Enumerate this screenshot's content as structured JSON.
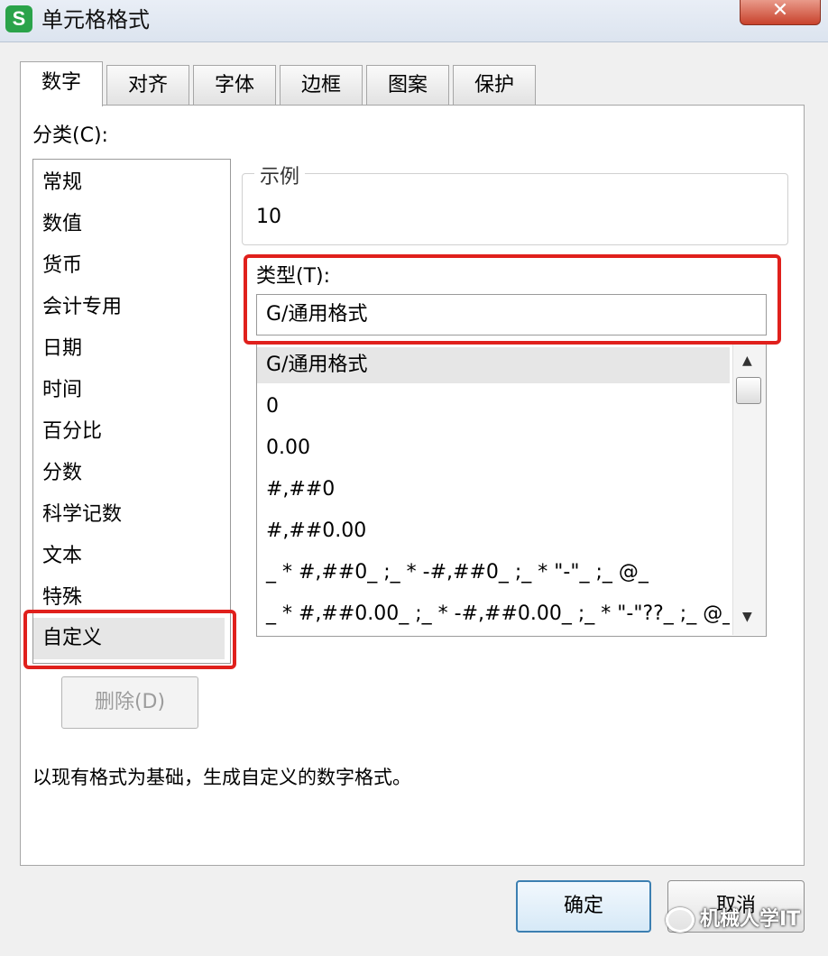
{
  "window": {
    "title": "单元格格式",
    "app_icon_letter": "S",
    "close_symbol": "✕"
  },
  "tabs": [
    {
      "label": "数字",
      "active": true
    },
    {
      "label": "对齐",
      "active": false
    },
    {
      "label": "字体",
      "active": false
    },
    {
      "label": "边框",
      "active": false
    },
    {
      "label": "图案",
      "active": false
    },
    {
      "label": "保护",
      "active": false
    }
  ],
  "category": {
    "label": "分类(C):",
    "items": [
      "常规",
      "数值",
      "货币",
      "会计专用",
      "日期",
      "时间",
      "百分比",
      "分数",
      "科学记数",
      "文本",
      "特殊",
      "自定义"
    ],
    "selected": "自定义"
  },
  "sample": {
    "title": "示例",
    "value": "10"
  },
  "type": {
    "label": "类型(T):",
    "input_value": "G/通用格式",
    "list": [
      "G/通用格式",
      "0",
      "0.00",
      "#,##0",
      "#,##0.00",
      "_ * #,##0_ ;_ * -#,##0_ ;_ * \"-\"_ ;_ @_",
      "_ * #,##0.00_ ;_ * -#,##0.00_ ;_ * \"-\"??_ ;_ @_"
    ],
    "selected": "G/通用格式"
  },
  "buttons": {
    "delete": "删除(D)",
    "ok": "确定",
    "cancel": "取消"
  },
  "description": "以现有格式为基础，生成自定义的数字格式。",
  "watermark": "机械人学IT",
  "colors": {
    "highlight_box": "#e0201c",
    "app_icon": "#2aa34a",
    "ok_border": "#3c7fb1"
  }
}
